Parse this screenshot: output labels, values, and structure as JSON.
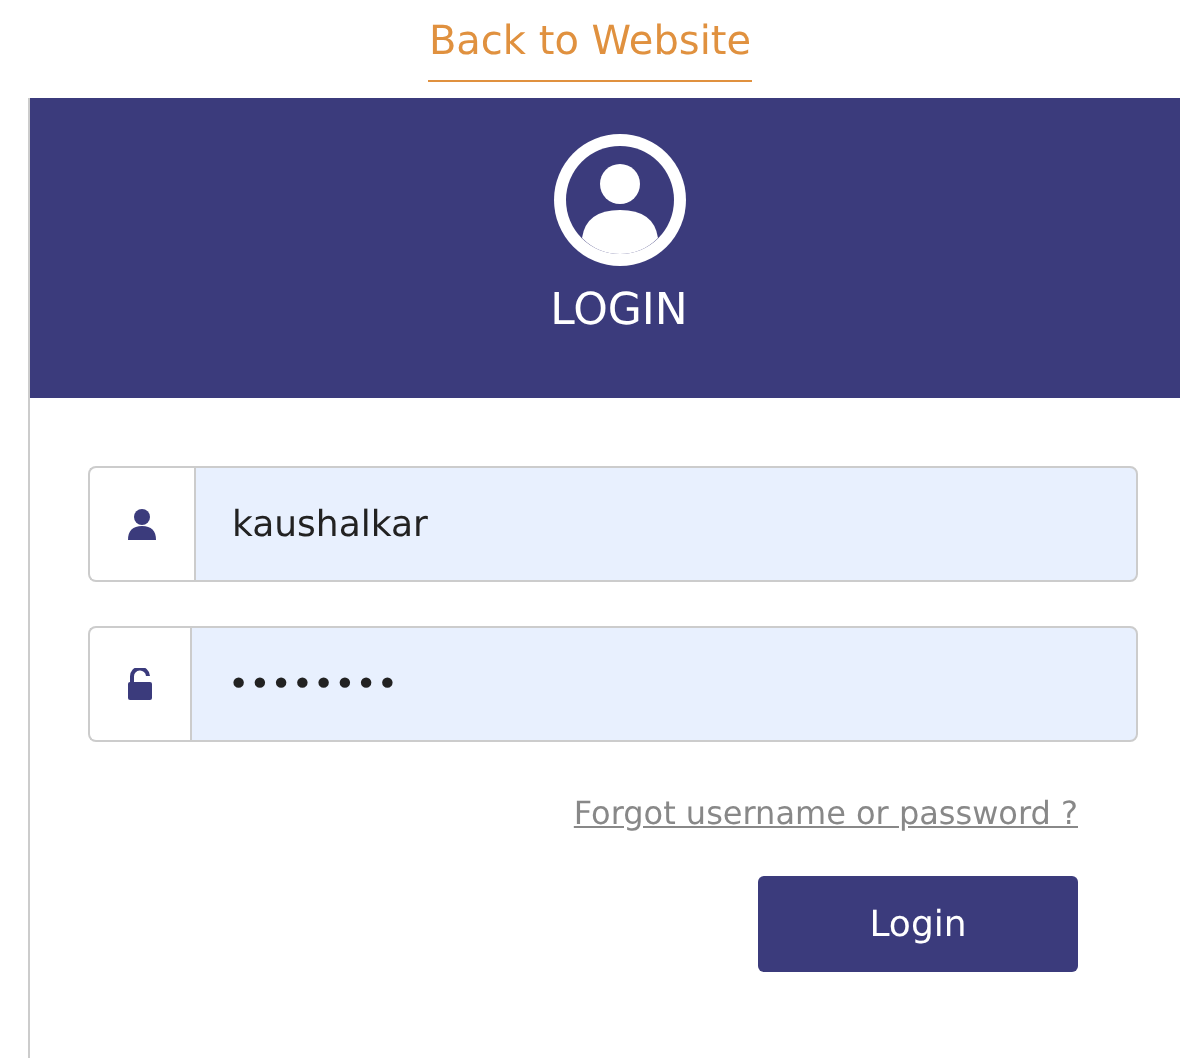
{
  "back_link": "Back to Website",
  "header": {
    "title": "LOGIN"
  },
  "fields": [
    {
      "kind": "user",
      "value": "kaushalkar"
    },
    {
      "kind": "lock",
      "value": "••••••••"
    }
  ],
  "forgot_link": "Forgot username or password ?",
  "submit": "Login"
}
